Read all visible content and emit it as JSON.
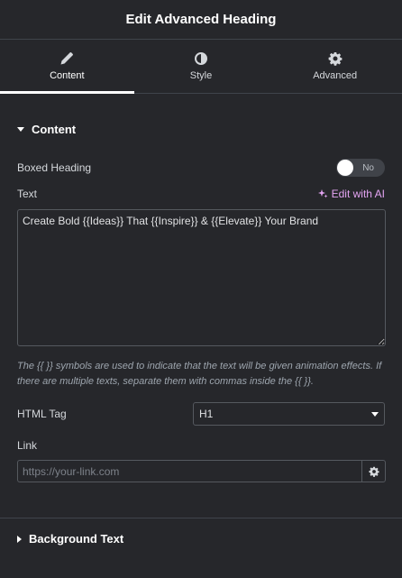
{
  "header": {
    "title": "Edit Advanced Heading"
  },
  "tabs": [
    {
      "label": "Content",
      "icon": "pencil-icon",
      "active": true
    },
    {
      "label": "Style",
      "icon": "half-circle-icon",
      "active": false
    },
    {
      "label": "Advanced",
      "icon": "gear-icon",
      "active": false
    }
  ],
  "content_section": {
    "title": "Content",
    "boxed_heading": {
      "label": "Boxed Heading",
      "toggle_text": "No"
    },
    "text": {
      "label": "Text",
      "ai_link": "Edit with AI",
      "value": "Create Bold {{Ideas}} That {{Inspire}} & {{Elevate}} Your Brand"
    },
    "help_text": "The {{ }} symbols are used to indicate that the text will be given animation effects. If there are multiple texts, separate them with commas inside the {{ }}.",
    "html_tag": {
      "label": "HTML Tag",
      "value": "H1"
    },
    "link": {
      "label": "Link",
      "placeholder": "https://your-link.com"
    }
  },
  "background_section": {
    "title": "Background Text"
  },
  "colors": {
    "background": "#26272b",
    "accent_ai": "#e3a4f2",
    "border": "#3f444b"
  }
}
